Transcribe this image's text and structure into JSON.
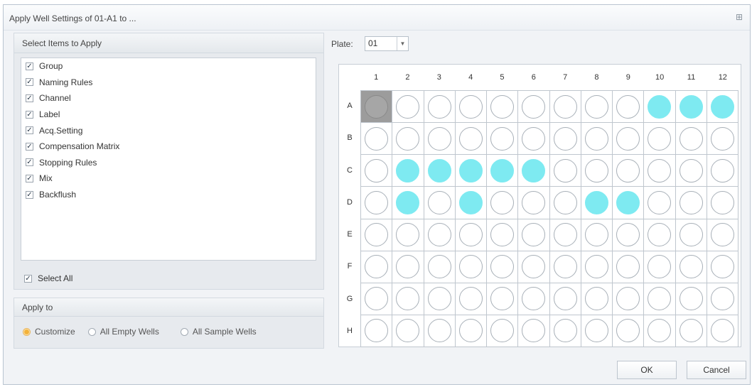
{
  "dialog": {
    "title": "Apply Well Settings of  01-A1 to ...",
    "close_icon": "close-icon"
  },
  "select_items": {
    "header": "Select Items to Apply",
    "items": [
      {
        "label": "Group",
        "checked": true
      },
      {
        "label": "Naming Rules",
        "checked": true
      },
      {
        "label": "Channel",
        "checked": true
      },
      {
        "label": "Label",
        "checked": true
      },
      {
        "label": "Acq.Setting",
        "checked": true
      },
      {
        "label": "Compensation Matrix",
        "checked": true
      },
      {
        "label": "Stopping Rules",
        "checked": true
      },
      {
        "label": "Mix",
        "checked": true
      },
      {
        "label": "Backflush",
        "checked": true
      }
    ],
    "select_all": {
      "label": "Select All",
      "checked": true
    }
  },
  "apply_to": {
    "header": "Apply to",
    "options": [
      {
        "label": "Customize",
        "checked": true
      },
      {
        "label": "All Empty Wells",
        "checked": false
      },
      {
        "label": "All Sample Wells",
        "checked": false
      }
    ]
  },
  "plate": {
    "label": "Plate:",
    "value": "01"
  },
  "grid": {
    "columns": [
      "1",
      "2",
      "3",
      "4",
      "5",
      "6",
      "7",
      "8",
      "9",
      "10",
      "11",
      "12"
    ],
    "rows": [
      "A",
      "B",
      "C",
      "D",
      "E",
      "F",
      "G",
      "H"
    ],
    "selected_well": "A1",
    "filled_wells": [
      "A10",
      "A11",
      "A12",
      "C2",
      "C3",
      "C4",
      "C5",
      "C6",
      "D2",
      "D4",
      "D8",
      "D9"
    ],
    "colors": {
      "filled": "#7eeaf1",
      "selected": "#9c9c9c"
    }
  },
  "buttons": {
    "ok": "OK",
    "cancel": "Cancel"
  }
}
